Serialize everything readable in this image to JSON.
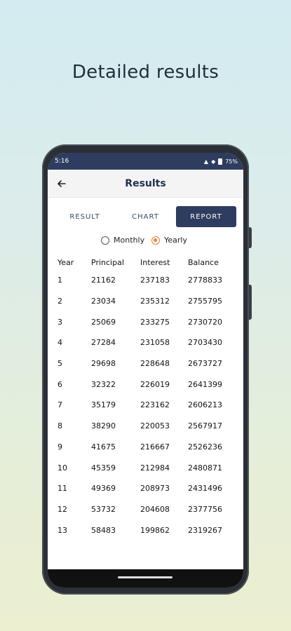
{
  "promo": {
    "title": "Detailed results"
  },
  "status_bar": {
    "time": "5:16",
    "battery": "75%"
  },
  "header": {
    "title": "Results",
    "back_icon": "arrow-left-icon"
  },
  "tabs": [
    {
      "label": "RESULT",
      "active": false
    },
    {
      "label": "CHART",
      "active": false
    },
    {
      "label": "REPORT",
      "active": true
    }
  ],
  "period": {
    "options": [
      {
        "label": "Monthly",
        "selected": false
      },
      {
        "label": "Yearly",
        "selected": true
      }
    ]
  },
  "report": {
    "columns": [
      "Year",
      "Principal",
      "Interest",
      "Balance"
    ],
    "rows": [
      [
        "1",
        "21162",
        "237183",
        "2778833"
      ],
      [
        "2",
        "23034",
        "235312",
        "2755795"
      ],
      [
        "3",
        "25069",
        "233275",
        "2730720"
      ],
      [
        "4",
        "27284",
        "231058",
        "2703430"
      ],
      [
        "5",
        "29698",
        "228648",
        "2673727"
      ],
      [
        "6",
        "32322",
        "226019",
        "2641399"
      ],
      [
        "7",
        "35179",
        "223162",
        "2606213"
      ],
      [
        "8",
        "38290",
        "220053",
        "2567917"
      ],
      [
        "9",
        "41675",
        "216667",
        "2526236"
      ],
      [
        "10",
        "45359",
        "212984",
        "2480871"
      ],
      [
        "11",
        "49369",
        "208973",
        "2431496"
      ],
      [
        "12",
        "53732",
        "204608",
        "2377756"
      ],
      [
        "13",
        "58483",
        "199862",
        "2319267"
      ]
    ]
  },
  "colors": {
    "primary": "#2e3d5f",
    "radio_accent": "#f08030"
  }
}
